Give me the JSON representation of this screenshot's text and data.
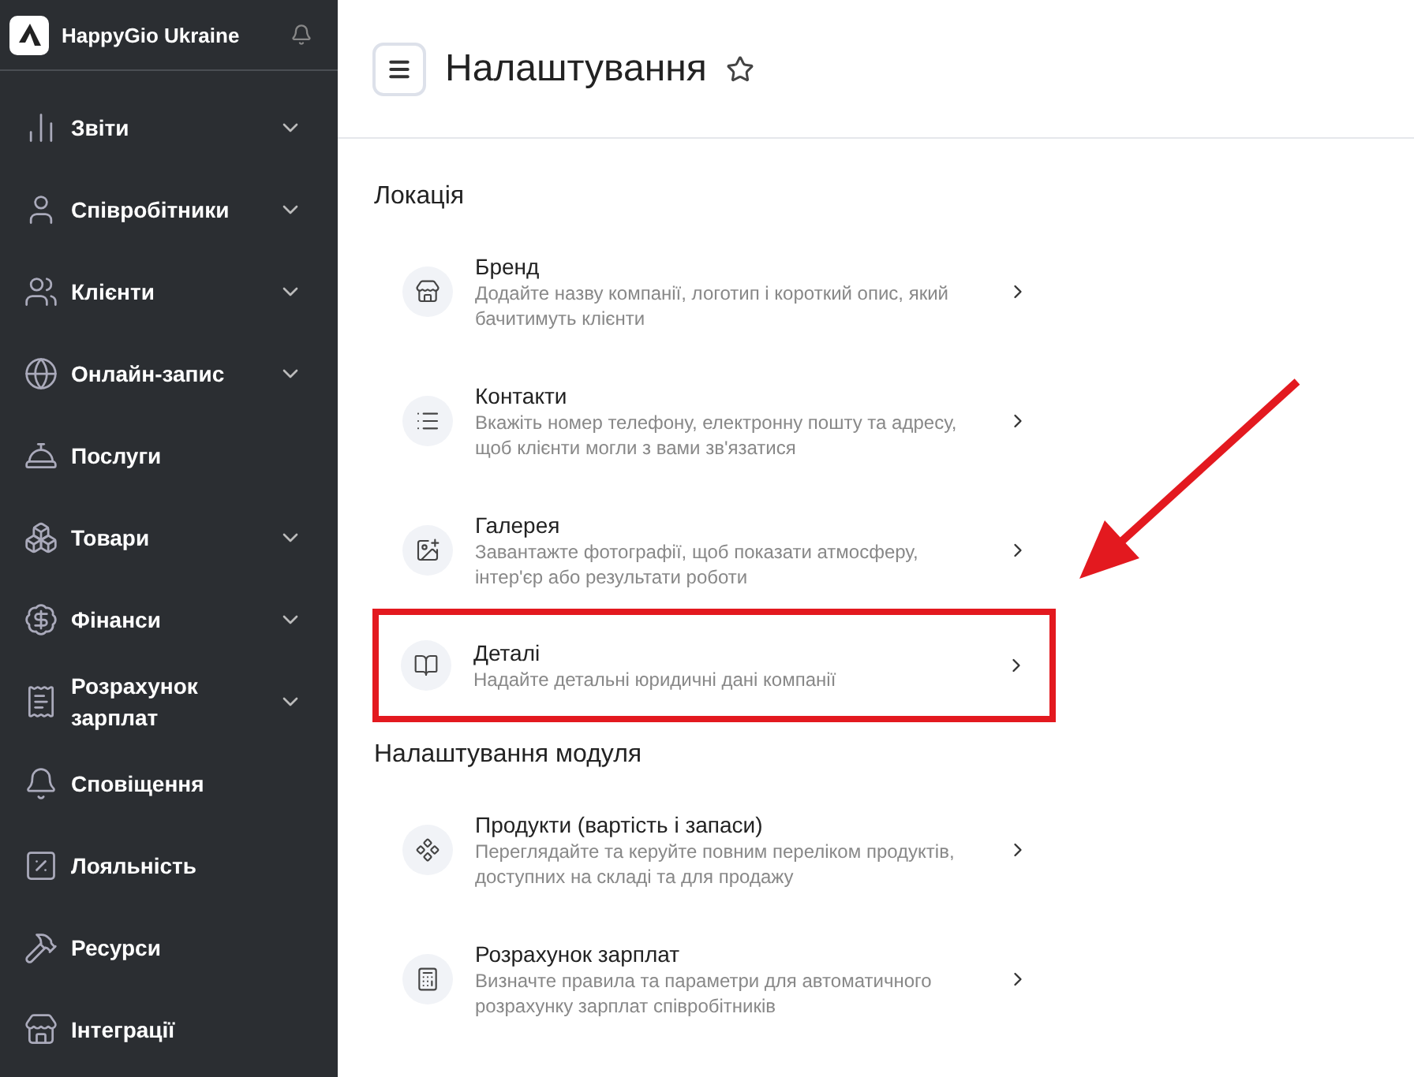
{
  "sidebar": {
    "company": "HappyGio Ukraine",
    "items": [
      {
        "label": "Звіти",
        "expandable": true
      },
      {
        "label": "Співробітники",
        "expandable": true
      },
      {
        "label": "Клієнти",
        "expandable": true
      },
      {
        "label": "Онлайн-запис",
        "expandable": true
      },
      {
        "label": "Послуги",
        "expandable": false
      },
      {
        "label": "Товари",
        "expandable": true
      },
      {
        "label": "Фінанси",
        "expandable": true
      },
      {
        "label": "Розрахунок зарплат",
        "expandable": true
      },
      {
        "label": "Сповіщення",
        "expandable": false
      },
      {
        "label": "Лояльність",
        "expandable": false
      },
      {
        "label": "Ресурси",
        "expandable": false
      },
      {
        "label": "Інтеграції",
        "expandable": false
      }
    ]
  },
  "header": {
    "title": "Налаштування",
    "favorite": false
  },
  "sections": [
    {
      "title": "Локація",
      "items": [
        {
          "title": "Бренд",
          "description": "Додайте назву компанії, логотип і короткий опис, який бачитимуть клієнти",
          "highlighted": false
        },
        {
          "title": "Контакти",
          "description": "Вкажіть номер телефону, електронну пошту та адресу, щоб клієнти могли з вами зв'язатися",
          "highlighted": false
        },
        {
          "title": "Галерея",
          "description": "Завантажте фотографії, щоб показати атмосферу, інтер'єр або результати роботи",
          "highlighted": false
        },
        {
          "title": "Деталі",
          "description": "Надайте детальні юридичні дані компанії",
          "highlighted": true
        }
      ]
    },
    {
      "title": "Налаштування модуля",
      "items": [
        {
          "title": "Продукти (вартість і запаси)",
          "description": "Переглядайте та керуйте повним переліком продуктів, доступних на складі та для продажу",
          "highlighted": false
        },
        {
          "title": "Розрахунок зарплат",
          "description": "Визначте правила та параметри для автоматичного розрахунку зарплат співробітників",
          "highlighted": false
        }
      ]
    }
  ]
}
